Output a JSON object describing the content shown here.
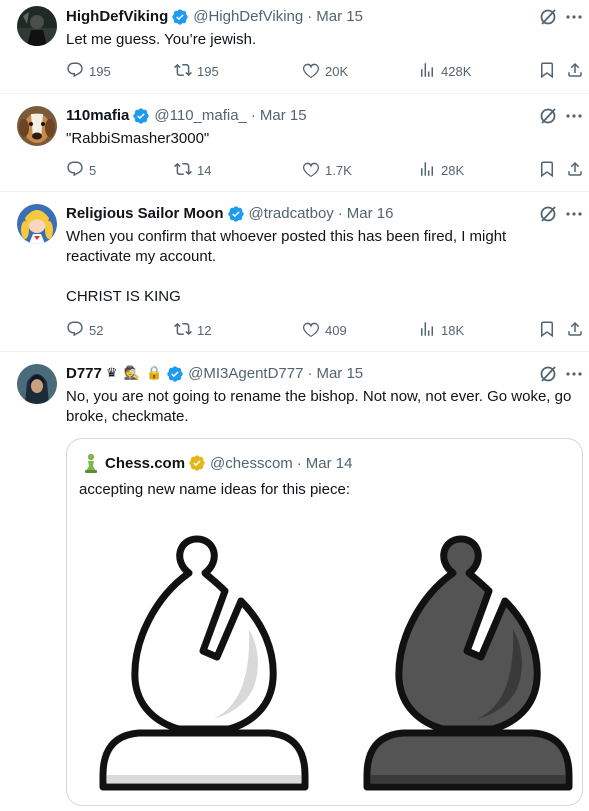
{
  "tweets": [
    {
      "name": "HighDefViking",
      "handle": "@HighDefViking",
      "date": "Mar 15",
      "text": "Let me guess. You’re jewish.",
      "replies": "195",
      "retweets": "195",
      "likes": "20K",
      "views": "428K"
    },
    {
      "name": "110mafia",
      "handle": "@110_mafia_",
      "date": "Mar 15",
      "text": "\"RabbiSmasher3000\"",
      "replies": "5",
      "retweets": "14",
      "likes": "1.7K",
      "views": "28K"
    },
    {
      "name": "Religious Sailor Moon",
      "handle": "@tradcatboy",
      "date": "Mar 16",
      "text": "When you confirm that whoever posted this has been fired, I might reactivate my account.\n\nCHRIST IS KING",
      "replies": "52",
      "retweets": "12",
      "likes": "409",
      "views": "18K"
    },
    {
      "name": "D777",
      "handle": "@MI3AgentD777",
      "date": "Mar 15",
      "text": "No, you are not going to rename the bishop. Not now, not ever. Go woke, go broke, checkmate.",
      "name_emojis": "♛ 🕵 🔒"
    }
  ],
  "quote": {
    "name": "Chess.com",
    "handle": "@chesscom",
    "date": "Mar 14",
    "text": "accepting new name ideas for this piece:",
    "pieces": [
      "white-bishop",
      "black-bishop"
    ]
  },
  "separator": "·",
  "colors": {
    "verified_blue": "#1d9bf0",
    "verified_gold": "#e2b719",
    "secondary_text": "#536471",
    "border": "#eff3f4",
    "chess_logo_green": "#81b64c"
  },
  "icons": [
    "reply-icon",
    "retweet-icon",
    "like-icon",
    "views-icon",
    "bookmark-icon",
    "share-icon",
    "grok-icon",
    "more-icon",
    "verified-badge-icon"
  ]
}
